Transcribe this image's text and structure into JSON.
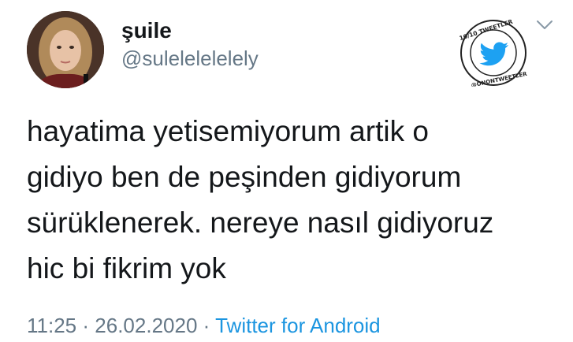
{
  "user": {
    "display_name": "şuile",
    "handle": "@sulelelelelely"
  },
  "badge": {
    "text_top": "10/10 TWEETLER",
    "text_bottom": "@ONONTWEETLER",
    "icon": "twitter-bird-icon"
  },
  "menu": {
    "icon": "chevron-down-icon"
  },
  "tweet": {
    "lines": [
      "hayatima yetisemiyorum artik o",
      "gidiyo ben de peşinden gidiyorum",
      "sürüklenerek. nereye nasıl gidiyoruz",
      "hic bi fikrim yok"
    ]
  },
  "meta": {
    "time": "11:25",
    "separator": "·",
    "date": "26.02.2020",
    "source": "Twitter for Android"
  },
  "colors": {
    "primary_text": "#14171a",
    "secondary_text": "#657786",
    "link": "#1b95e0",
    "twitter_blue": "#1da1f2"
  }
}
